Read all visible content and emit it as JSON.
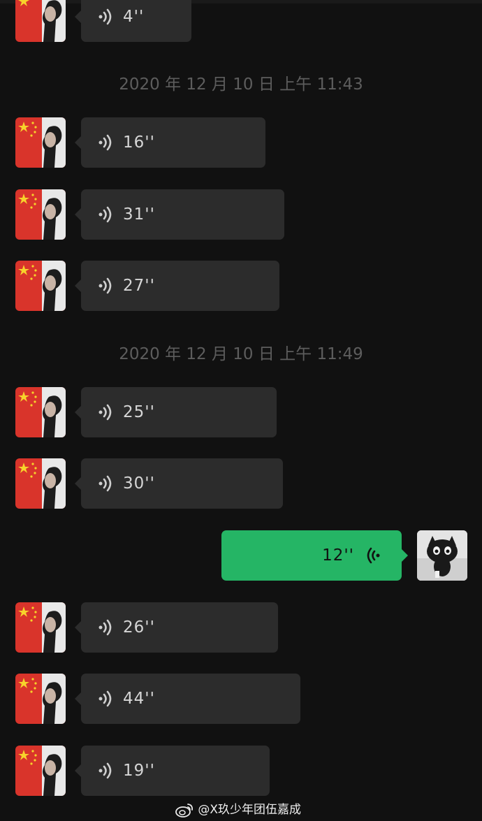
{
  "messages_before": [
    {
      "duration": "4''",
      "bubble_width": 158
    }
  ],
  "timestamp_1": "2020 年 12 月 10 日 上午 11:43",
  "group_1": [
    {
      "duration": "16''"
    },
    {
      "duration": "31''"
    },
    {
      "duration": "27''"
    }
  ],
  "timestamp_2": "2020 年 12 月 10 日 上午 11:49",
  "group_2": [
    {
      "duration": "25''"
    },
    {
      "duration": "30''"
    }
  ],
  "sent_message": {
    "duration": "12''"
  },
  "group_3": [
    {
      "duration": "26''"
    },
    {
      "duration": "44''"
    },
    {
      "duration": "19''"
    }
  ],
  "watermark": {
    "text": "@X玖少年团伍嘉成"
  },
  "colors": {
    "background": "#111111",
    "received_bubble": "#2c2c2c",
    "sent_bubble": "#25b565",
    "timestamp_text": "#5d5d5d"
  },
  "icons": {
    "received_voice": "voice-wave-icon",
    "sent_voice": "voice-wave-icon",
    "watermark": "weibo-icon"
  }
}
